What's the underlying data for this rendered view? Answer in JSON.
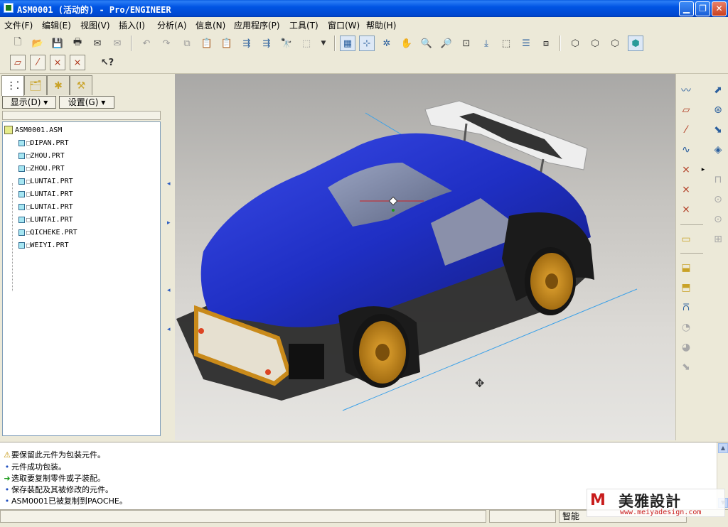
{
  "window": {
    "title": "ASM0001 (活动的) - Pro/ENGINEER",
    "minimize_icon": "minimize-icon",
    "maximize_icon": "restore-icon",
    "close_icon": "close-icon"
  },
  "menu": {
    "items": [
      "文件(F)",
      "编辑(E)",
      "视图(V)",
      "插入(I)",
      "分析(A)",
      "信息(N)",
      "应用程序(P)",
      "工具(T)",
      "窗口(W)",
      "帮助(H)"
    ]
  },
  "toolbar": {
    "row1_icons": [
      "new-file-icon",
      "open-folder-icon",
      "save-icon",
      "print-icon",
      "email-icon",
      "email-attach-icon",
      "undo-icon",
      "redo-icon",
      "copy-icon",
      "paste-icon",
      "paste-special-icon",
      "regenerate-icon",
      "regenerate-manager-icon",
      "find-icon",
      "select-box-icon",
      "view-manager-icon",
      "orient-icon",
      "repaint-icon",
      "spin-center-icon",
      "zoom-in-icon",
      "zoom-out-icon",
      "refit-icon",
      "reorient-icon",
      "saved-views-icon",
      "layers-icon",
      "view-manager-2-icon",
      "wireframe-icon",
      "hidden-line-icon",
      "no-hidden-icon",
      "shading-icon"
    ],
    "row2_icons": [
      "datum-plane-display-icon",
      "datum-axis-display-icon",
      "datum-point-display-icon",
      "coordinate-system-display-icon",
      "context-help-icon"
    ]
  },
  "model_tree": {
    "tabs": [
      "model-tree-tab-icon",
      "folder-browser-tab-icon",
      "favorites-tab-icon",
      "connections-tab-icon"
    ],
    "show_button": "显示(D)",
    "settings_button": "设置(G)",
    "root": "ASM0001.ASM",
    "items": [
      "DIPAN.PRT",
      "ZHOU.PRT",
      "ZHOU.PRT",
      "LUNTAI.PRT",
      "LUNTAI.PRT",
      "LUNTAI.PRT",
      "LUNTAI.PRT",
      "QICHEKE.PRT",
      "WEIYI.PRT"
    ]
  },
  "messages": [
    {
      "icon": "warning-icon",
      "text": "要保留此元件为包装元件。"
    },
    {
      "icon": "info-bullet-icon",
      "text": "元件成功包装。"
    },
    {
      "icon": "prompt-arrow-icon",
      "text": "选取要复制零件或子装配。"
    },
    {
      "icon": "info-bullet-icon",
      "text": "保存装配及其被修改的元件。"
    },
    {
      "icon": "info-bullet-icon",
      "text": "ASM0001已被复制到PAOCHE。"
    }
  ],
  "status": {
    "filter": "智能"
  },
  "watermark": {
    "text": "美雅設計",
    "url": "www.meiyadesign.com"
  },
  "colors": {
    "titlebar": "#0054e3",
    "car_body": "#2233cc",
    "wheel_rim": "#c98a1a",
    "datum_axis": "#3aa0e8"
  }
}
